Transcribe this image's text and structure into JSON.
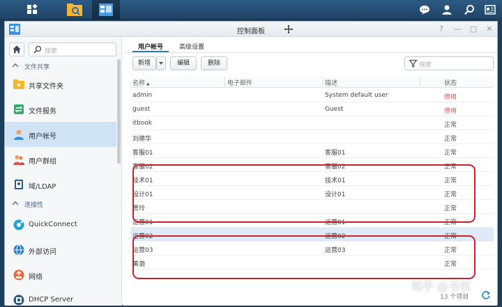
{
  "window": {
    "title": "控制面板",
    "controls": [
      "?",
      "—",
      "▢",
      "✕"
    ]
  },
  "sidebar": {
    "search_placeholder": "搜索",
    "sections": [
      {
        "label": "文件共享",
        "items": [
          {
            "label": "共享文件夹",
            "icon": "shared-folder-icon"
          },
          {
            "label": "文件服务",
            "icon": "file-service-icon"
          },
          {
            "label": "用户帐号",
            "icon": "user-icon",
            "active": true
          },
          {
            "label": "用户群组",
            "icon": "group-icon"
          },
          {
            "label": "域/LDAP",
            "icon": "domain-icon"
          }
        ]
      },
      {
        "label": "连接性",
        "items": [
          {
            "label": "QuickConnect",
            "icon": "quickconnect-icon"
          },
          {
            "label": "外部访问",
            "icon": "external-access-icon"
          },
          {
            "label": "网络",
            "icon": "network-icon"
          },
          {
            "label": "DHCP Server",
            "icon": "dhcp-icon"
          }
        ]
      }
    ]
  },
  "main": {
    "tabs": [
      {
        "label": "用户帐号",
        "active": true
      },
      {
        "label": "高级设置",
        "active": false
      }
    ],
    "toolbar": {
      "create_label": "新增",
      "edit_label": "编辑",
      "delete_label": "删除",
      "filter_placeholder": "搜索"
    },
    "columns": {
      "name": "名称",
      "sort_indicator": "▲",
      "email": "电子邮件",
      "description": "描述",
      "status": "状态"
    },
    "rows": [
      {
        "name": "admin",
        "email": "",
        "description": "System default user",
        "status": "停用",
        "disabled": true
      },
      {
        "name": "guest",
        "email": "",
        "description": "Guest",
        "status": "停用",
        "disabled": true
      },
      {
        "name": "itbook",
        "email": "",
        "description": "",
        "status": "正常"
      },
      {
        "name": "刘德华",
        "email": "",
        "description": "",
        "status": "正常"
      },
      {
        "name": "客服01",
        "email": "",
        "description": "客服01",
        "status": "正常"
      },
      {
        "name": "客服02",
        "email": "",
        "description": "客服02",
        "status": "正常"
      },
      {
        "name": "技术01",
        "email": "",
        "description": "技术01",
        "status": "正常"
      },
      {
        "name": "设计01",
        "email": "",
        "description": "设计01",
        "status": "正常"
      },
      {
        "name": "贾玲",
        "email": "",
        "description": "",
        "status": "正常"
      },
      {
        "name": "运营01",
        "email": "",
        "description": "运营01",
        "status": "正常"
      },
      {
        "name": "运营02",
        "email": "",
        "description": "运营02",
        "status": "正常",
        "selected": true
      },
      {
        "name": "运营03",
        "email": "",
        "description": "运营03",
        "status": "正常"
      },
      {
        "name": "黄渤",
        "email": "",
        "description": "",
        "status": "正常"
      }
    ],
    "footer_count": "13 个项目"
  },
  "watermark": "知乎 @书包",
  "colors": {
    "accent": "#2a7bc4",
    "disabled_status": "#d9534f",
    "highlight_border": "#c8202a",
    "taskbar": "#2d5a84"
  }
}
